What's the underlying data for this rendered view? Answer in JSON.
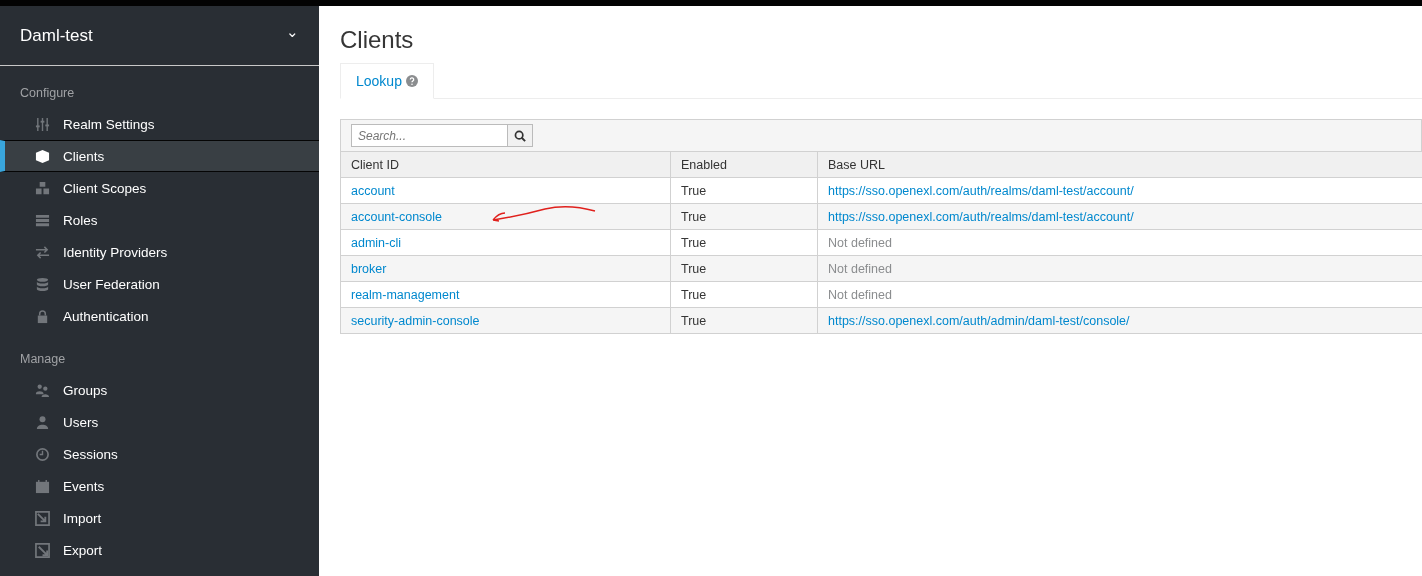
{
  "sidebar": {
    "realm": "Daml-test",
    "realm_caret": "⌄",
    "sections": [
      {
        "title": "Configure",
        "items": [
          {
            "label": "Realm Settings",
            "selected": false
          },
          {
            "label": "Clients",
            "selected": true
          },
          {
            "label": "Client Scopes",
            "selected": false
          },
          {
            "label": "Roles",
            "selected": false
          },
          {
            "label": "Identity Providers",
            "selected": false
          },
          {
            "label": "User Federation",
            "selected": false
          },
          {
            "label": "Authentication",
            "selected": false
          }
        ]
      },
      {
        "title": "Manage",
        "items": [
          {
            "label": "Groups",
            "selected": false
          },
          {
            "label": "Users",
            "selected": false
          },
          {
            "label": "Sessions",
            "selected": false
          },
          {
            "label": "Events",
            "selected": false
          },
          {
            "label": "Import",
            "selected": false
          },
          {
            "label": "Export",
            "selected": false
          }
        ]
      }
    ]
  },
  "page": {
    "title": "Clients",
    "tabs": [
      {
        "label": "Lookup",
        "selected": true
      }
    ]
  },
  "search": {
    "placeholder": "Search..."
  },
  "table": {
    "columns": [
      "Client ID",
      "Enabled",
      "Base URL"
    ],
    "rows": [
      {
        "client_id": "account",
        "enabled": "True",
        "base_url": "https://sso.openexl.com/auth/realms/daml-test/account/",
        "defined": true
      },
      {
        "client_id": "account-console",
        "enabled": "True",
        "base_url": "https://sso.openexl.com/auth/realms/daml-test/account/",
        "defined": true
      },
      {
        "client_id": "admin-cli",
        "enabled": "True",
        "base_url": "Not defined",
        "defined": false
      },
      {
        "client_id": "broker",
        "enabled": "True",
        "base_url": "Not defined",
        "defined": false
      },
      {
        "client_id": "realm-management",
        "enabled": "True",
        "base_url": "Not defined",
        "defined": false
      },
      {
        "client_id": "security-admin-console",
        "enabled": "True",
        "base_url": "https://sso.openexl.com/auth/admin/daml-test/console/",
        "defined": true
      }
    ]
  }
}
